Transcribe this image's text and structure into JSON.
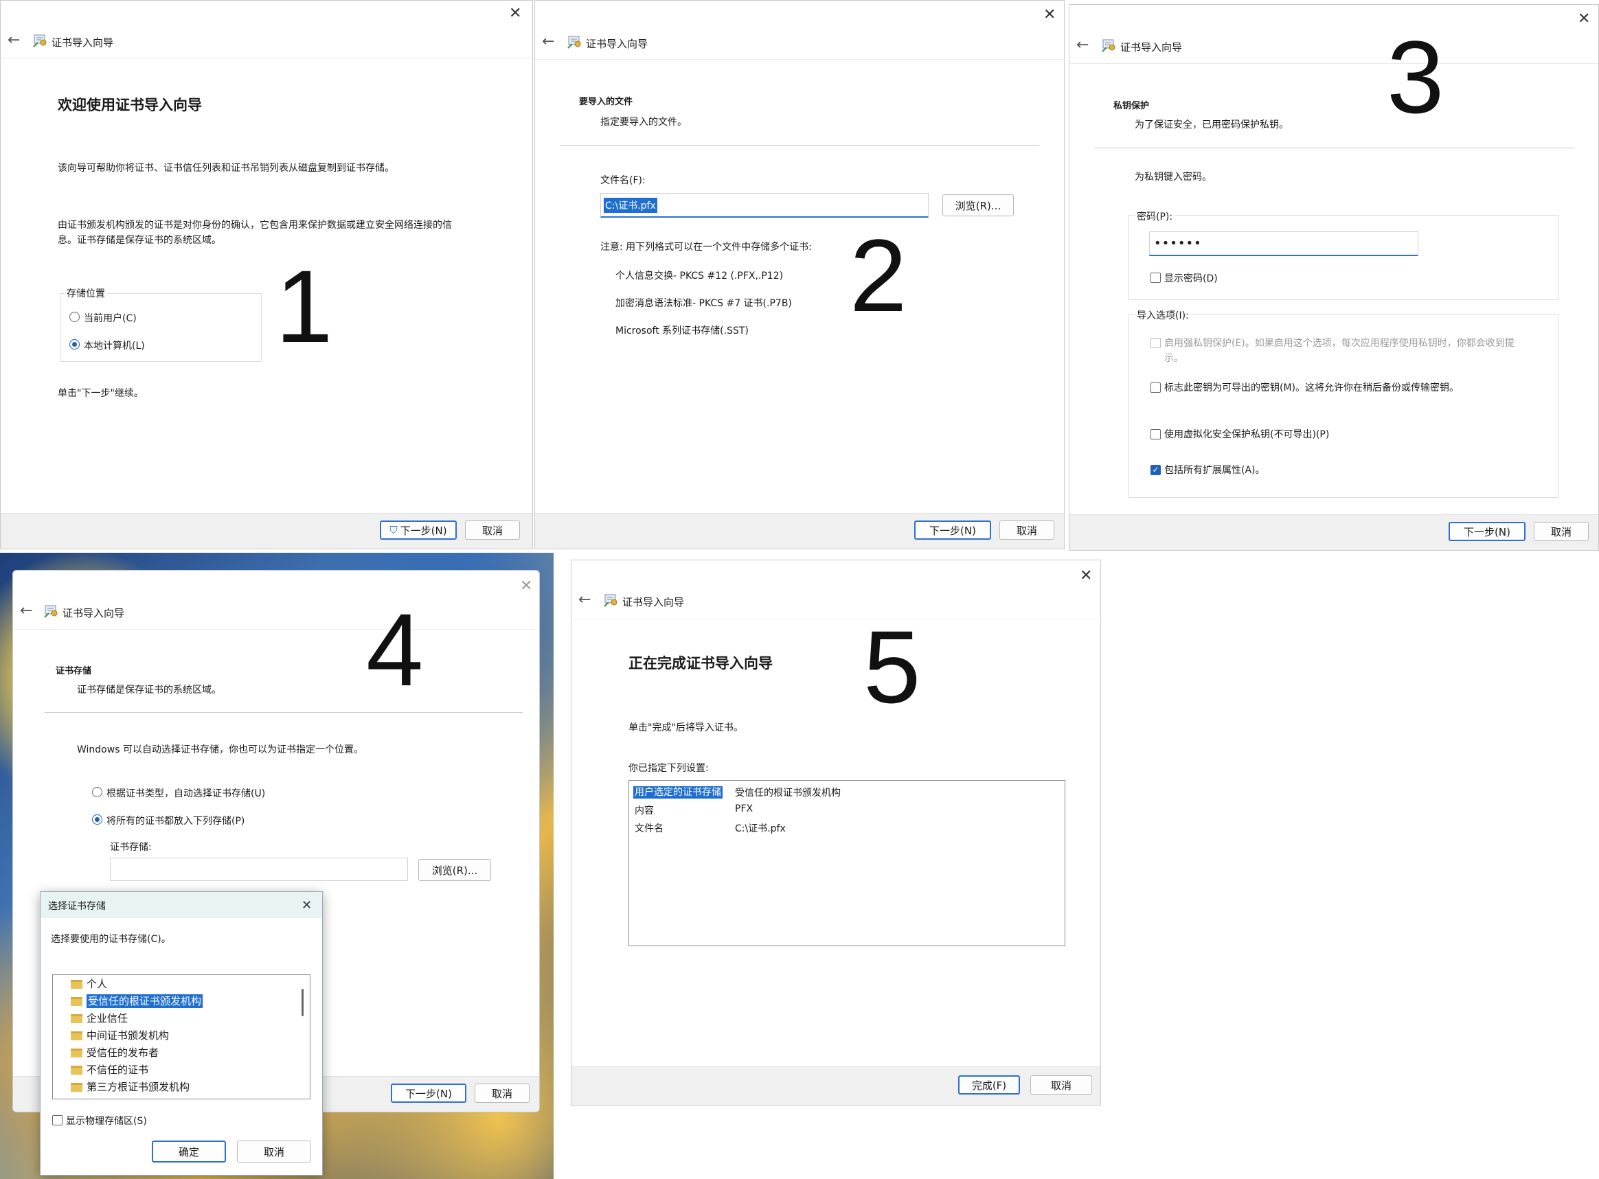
{
  "wizard_title": "证书导入向导",
  "common": {
    "next": "下一步(N)",
    "cancel": "取消",
    "finish": "完成(F)",
    "browse": "浏览(R)..."
  },
  "panel1": {
    "number": "1",
    "heading": "欢迎使用证书导入向导",
    "para1": "该向导可帮助你将证书、证书信任列表和证书吊销列表从磁盘复制到证书存储。",
    "para2_line1": "由证书颁发机构颁发的证书是对你身份的确认，它包含用来保护数据或建立安全网络连接的信",
    "para2_line2": "息。证书存储是保存证书的系统区域。",
    "store_group": "存储位置",
    "opt_current_user": "当前用户(C)",
    "opt_local_machine": "本地计算机(L)",
    "continue": "单击\"下一步\"继续。"
  },
  "panel2": {
    "number": "2",
    "section": "要导入的文件",
    "subtitle": "指定要导入的文件。",
    "file_label": "文件名(F):",
    "file_value": "C:\\证书.pfx",
    "note": "注意: 用下列格式可以在一个文件中存储多个证书:",
    "formats": [
      "个人信息交换- PKCS #12 (.PFX,.P12)",
      "加密消息语法标准- PKCS #7 证书(.P7B)",
      "Microsoft 系列证书存储(.SST)"
    ]
  },
  "panel3": {
    "number": "3",
    "section": "私钥保护",
    "subtitle": "为了保证安全，已用密码保护私钥。",
    "prompt": "为私钥键入密码。",
    "pwd_label": "密码(P):",
    "pwd_value": "••••••",
    "show_pwd": "显示密码(D)",
    "import_opts": "导入选项(I):",
    "opt_strong_1": "启用强私钥保护(E)。如果启用这个选项，每次应用程序使用私钥时，你都会收到提",
    "opt_strong_2": "示。",
    "opt_exportable": "标志此密钥为可导出的密钥(M)。这将允许你在稍后备份或传输密钥。",
    "opt_vbs": "使用虚拟化安全保护私钥(不可导出)(P)",
    "opt_ext": "包括所有扩展属性(A)。"
  },
  "panel4": {
    "number": "4",
    "section": "证书存储",
    "subtitle": "证书存储是保存证书的系统区域。",
    "desc": "Windows 可以自动选择证书存储，你也可以为证书指定一个位置。",
    "opt_auto": "根据证书类型，自动选择证书存储(U)",
    "opt_manual": "将所有的证书都放入下列存储(P)",
    "store_label": "证书存储:",
    "dialog": {
      "title": "选择证书存储",
      "prompt": "选择要使用的证书存储(C)。",
      "items": [
        "个人",
        "受信任的根证书颁发机构",
        "企业信任",
        "中间证书颁发机构",
        "受信任的发布者",
        "不信任的证书",
        "第三方根证书颁发机构"
      ],
      "show_physical": "显示物理存储区(S)",
      "ok": "确定",
      "cancel": "取消"
    }
  },
  "panel5": {
    "number": "5",
    "heading": "正在完成证书导入向导",
    "instruction": "单击\"完成\"后将导入证书。",
    "settings_label": "你已指定下列设置:",
    "rows": [
      {
        "key": "用户选定的证书存储",
        "value": "受信任的根证书颁发机构"
      },
      {
        "key": "内容",
        "value": "PFX"
      },
      {
        "key": "文件名",
        "value": "C:\\证书.pfx"
      }
    ]
  }
}
